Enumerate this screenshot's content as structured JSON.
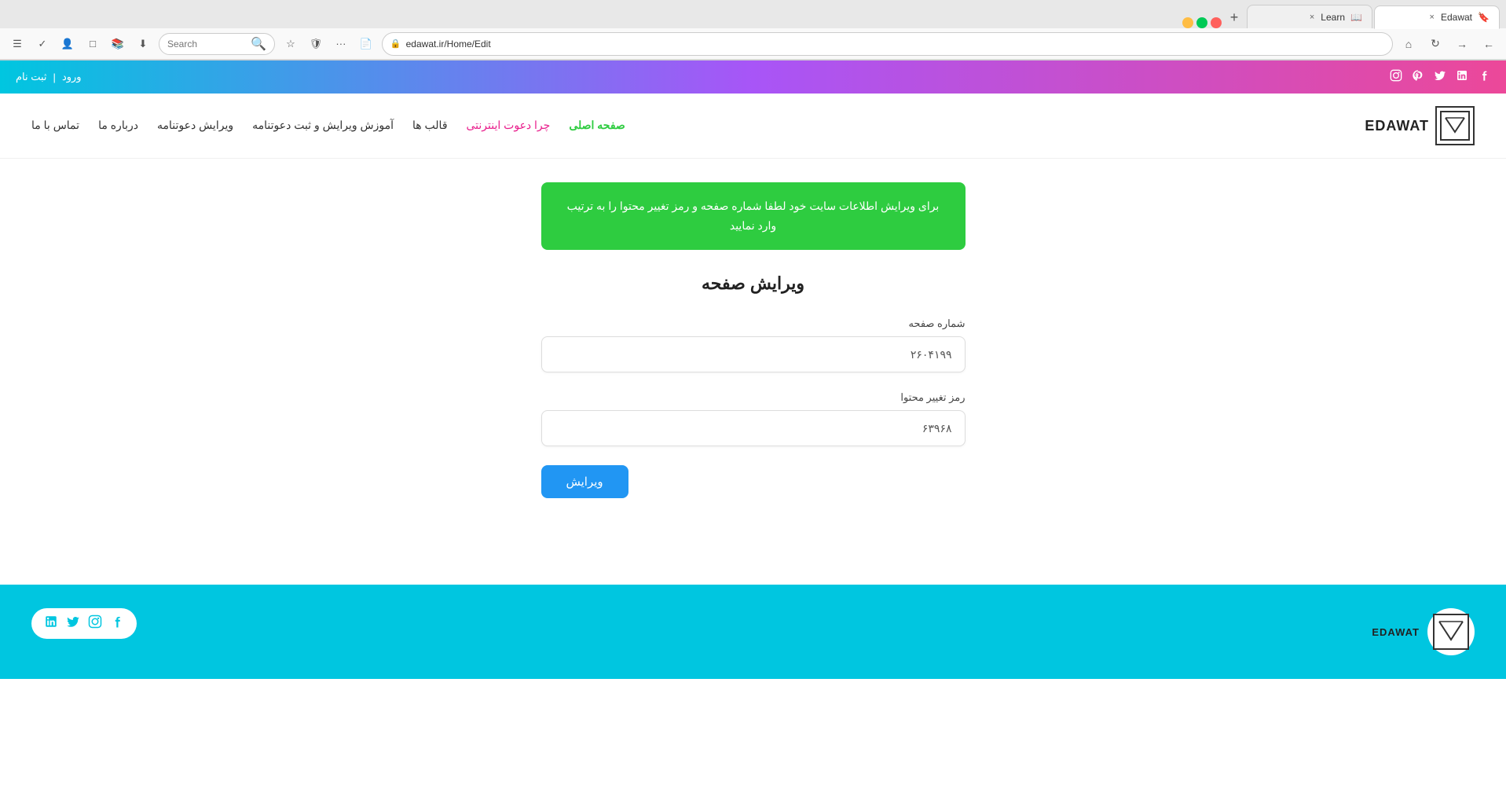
{
  "browser": {
    "tabs": [
      {
        "label": "Edawat",
        "favicon": "E",
        "active": true,
        "close": "×"
      },
      {
        "label": "Learn",
        "favicon": "L",
        "active": false,
        "close": "×"
      }
    ],
    "new_tab": "+",
    "address": "edawat.ir/Home/Edit",
    "search_placeholder": "Search",
    "nav_buttons": {
      "back": "←",
      "forward": "→",
      "refresh": "↻",
      "home": "⌂"
    },
    "win_controls": {
      "minimize": "—",
      "maximize": "□",
      "close": "✕"
    },
    "toolbar_icons": [
      "📄",
      "···",
      "🛡",
      "★",
      "⬇",
      "📚",
      "□",
      "👤",
      "✓",
      "☰"
    ]
  },
  "site": {
    "top_bar": {
      "social_icons": [
        "instagram",
        "pinterest",
        "twitter",
        "linkedin",
        "facebook"
      ],
      "login_text": "ورود",
      "separator": "|",
      "register_text": "ثبت نام"
    },
    "nav": {
      "logo_text": "EDAWAT",
      "items": [
        {
          "label": "صفحه اصلی",
          "active": true
        },
        {
          "label": "چرا دعوت اینترنتی",
          "highlight": true
        },
        {
          "label": "قالب ها",
          "active": false
        },
        {
          "label": "آموزش ویرایش و ثبت دعوتنامه",
          "active": false
        },
        {
          "label": "ویرایش دعوتنامه",
          "active": false
        },
        {
          "label": "درباره ما",
          "active": false
        },
        {
          "label": "تماس با ما",
          "active": false
        }
      ]
    },
    "info_box": {
      "text": "برای ویرایش اطلاعات سایت خود لطفا شماره صفحه و رمز تغییر محتوا را به ترتیب وارد نمایید"
    },
    "page_title": "ویرایش صفحه",
    "form": {
      "fields": [
        {
          "label": "شماره صفحه",
          "value": "۲۶۰۴۱۹۹",
          "name": "page-number"
        },
        {
          "label": "رمز تغییر محتوا",
          "value": "۶۳۹۶۸",
          "name": "content-password"
        }
      ],
      "submit_label": "ویرایش"
    },
    "footer": {
      "logo_text": "EDAWAT",
      "social_icons": [
        "facebook",
        "instagram",
        "twitter",
        "linkedin"
      ]
    }
  }
}
